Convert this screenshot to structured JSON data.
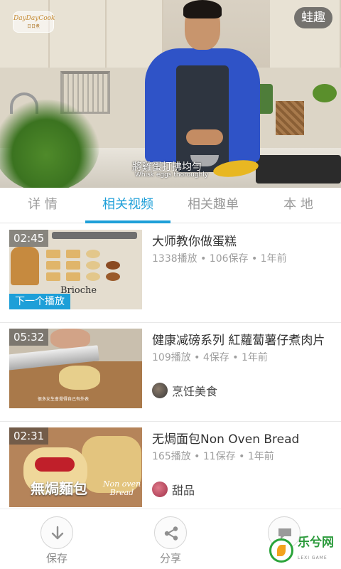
{
  "video": {
    "logo_text": "DayDayCook",
    "logo_sub": "日日煮",
    "brand_badge": "蛙趣",
    "subtitle_cn": "將雞蛋打拂均勻",
    "subtitle_en": "Whisk eggs thoroughly"
  },
  "tabs": [
    {
      "label": "详 情",
      "active": false
    },
    {
      "label": "相关视频",
      "active": true
    },
    {
      "label": "相关趣单",
      "active": false
    },
    {
      "label": "本 地",
      "active": false
    }
  ],
  "accent_color": "#1e9fd8",
  "videos": [
    {
      "duration": "02:45",
      "title": "大师教你做蛋糕",
      "meta": "1338播放 • 106保存 • 1年前",
      "badge": "下一个播放",
      "thumb_caption": "Brioche",
      "category": ""
    },
    {
      "duration": "05:32",
      "title": "健康减磅系列 紅蘿蔔薯仔煮肉片",
      "meta": "109播放 • 4保存 • 1年前",
      "category": "烹饪美食",
      "thumb_caption": "很多女生會覺得自己有外表"
    },
    {
      "duration": "02:31",
      "title": "无焗面包Non Oven Bread",
      "meta": "165播放 • 11保存 • 1年前",
      "category": "甜品",
      "thumb_cn": "無焗麵包",
      "thumb_en": "Non oven Bread"
    }
  ],
  "actions": [
    {
      "label": "保存",
      "icon": "download-icon"
    },
    {
      "label": "分享",
      "icon": "share-icon"
    },
    {
      "label": "",
      "icon": "comment-icon"
    }
  ],
  "watermark": {
    "text": "乐兮网",
    "sub": "LEXI GAME"
  }
}
